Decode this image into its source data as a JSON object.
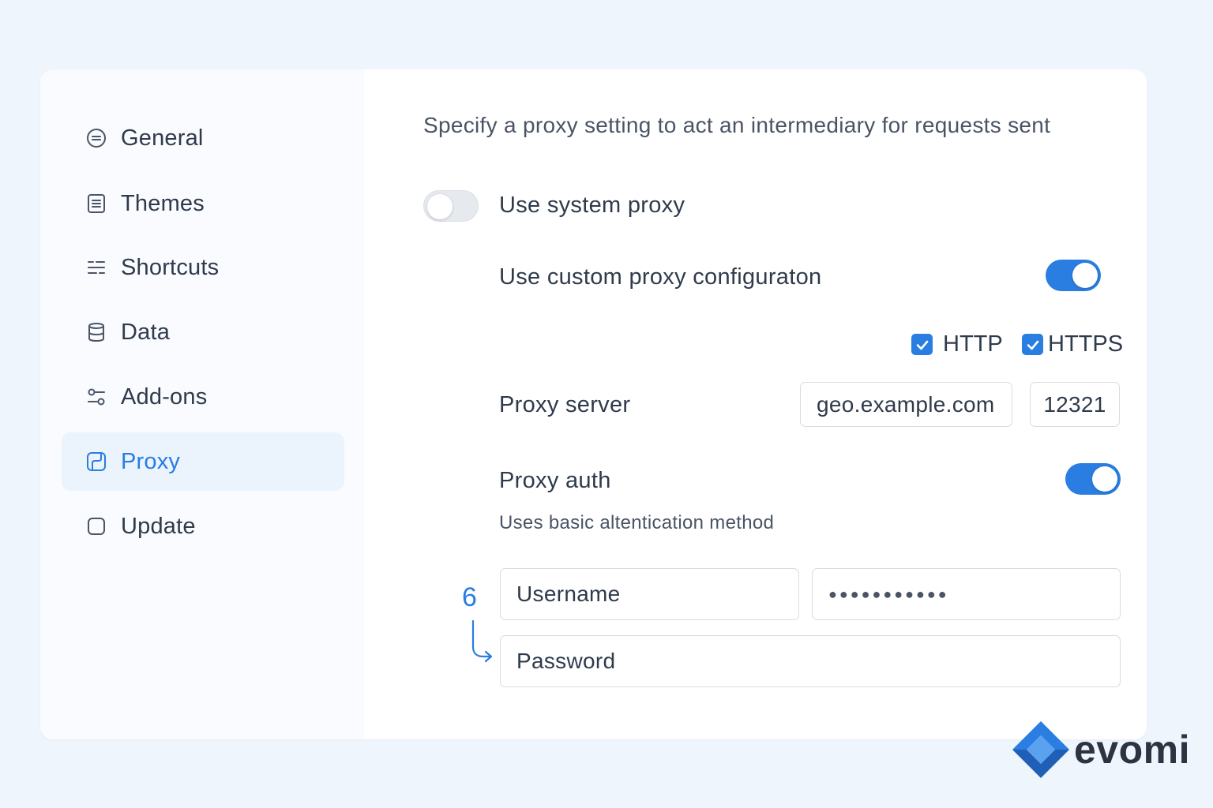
{
  "sidebar": {
    "items": [
      {
        "label": "General",
        "icon": "general-icon",
        "active": false
      },
      {
        "label": "Themes",
        "icon": "themes-icon",
        "active": false
      },
      {
        "label": "Shortcuts",
        "icon": "shortcuts-icon",
        "active": false
      },
      {
        "label": "Data",
        "icon": "database-icon",
        "active": false
      },
      {
        "label": "Add-ons",
        "icon": "addons-icon",
        "active": false
      },
      {
        "label": "Proxy",
        "icon": "proxy-icon",
        "active": true
      },
      {
        "label": "Update",
        "icon": "update-icon",
        "active": false
      }
    ]
  },
  "main": {
    "description": "Specify a proxy setting to act an intermediary for requests sent",
    "system_proxy": {
      "label": "Use system proxy",
      "enabled": false
    },
    "custom_proxy": {
      "label": "Use custom proxy configuraton",
      "enabled": true
    },
    "protocols": [
      {
        "label": "HTTP",
        "checked": true
      },
      {
        "label": "HTTPS",
        "checked": true
      }
    ],
    "proxy_server": {
      "label": "Proxy server",
      "host": "geo.example.com",
      "port": "12321"
    },
    "proxy_auth": {
      "label": "Proxy auth",
      "enabled": true,
      "hint": "Uses basic altentication method"
    },
    "username": {
      "placeholder": "Username"
    },
    "masked_value": "●●●●●●●●●●●",
    "password": {
      "placeholder": "Password"
    }
  },
  "annotation": {
    "number": "6"
  },
  "brand": {
    "name": "evomi"
  },
  "colors": {
    "accent": "#2a7de1",
    "background": "#eff5fc",
    "card": "#ffffff"
  }
}
